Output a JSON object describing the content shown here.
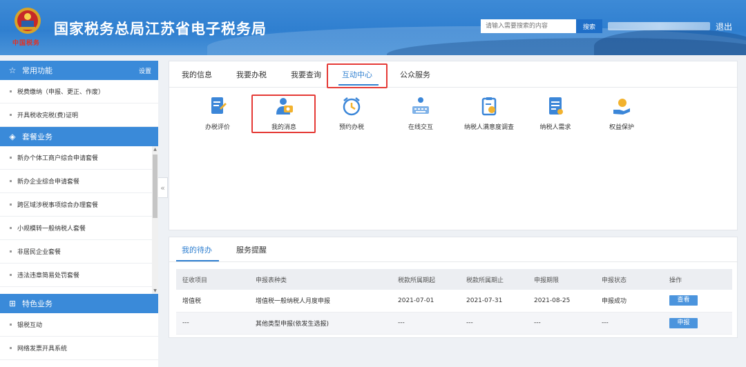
{
  "header": {
    "emblem_sub": "中国税务",
    "title": "国家税务总局江苏省电子税务局",
    "search_placeholder": "请输入需要搜索的内容",
    "search_button": "搜索",
    "logout": "退出"
  },
  "sidebar": {
    "common": {
      "title": "常用功能",
      "settings": "设置",
      "items": [
        "税费缴纳（申报、更正、作废）",
        "开具税收完税(费)证明"
      ]
    },
    "package": {
      "title": "套餐业务",
      "items": [
        "新办个体工商户综合申请套餐",
        "新办企业综合申请套餐",
        "跨区域涉税事项综合办理套餐",
        "小规模转一般纳税人套餐",
        "非居民企业套餐",
        "违法违章简易处罚套餐"
      ]
    },
    "special": {
      "title": "特色业务",
      "items": [
        "银税互动",
        "网络发票开具系统"
      ]
    },
    "collapse_icon": "double-chevron-left-icon"
  },
  "main_tabs": [
    "我的信息",
    "我要办税",
    "我要查询",
    "互动中心",
    "公众服务"
  ],
  "active_tab": "互动中心",
  "services": [
    {
      "label": "办税评价",
      "icon": "document-pen-icon"
    },
    {
      "label": "我的消息",
      "icon": "user-message-icon"
    },
    {
      "label": "预约办税",
      "icon": "alarm-clock-icon"
    },
    {
      "label": "在线交互",
      "icon": "keyboard-chat-icon"
    },
    {
      "label": "纳税人满意度调查",
      "icon": "clipboard-survey-icon"
    },
    {
      "label": "纳税人需求",
      "icon": "document-list-icon"
    },
    {
      "label": "权益保护",
      "icon": "hand-coin-icon"
    }
  ],
  "todo": {
    "tabs": [
      "我的待办",
      "服务提醒"
    ],
    "active_tab": "我的待办",
    "columns": [
      "征收项目",
      "申报表种类",
      "税款所属期起",
      "税款所属期止",
      "申报期限",
      "申报状态",
      "操作"
    ],
    "rows": [
      [
        "增值税",
        "增值税一般纳税人月度申报",
        "2021-07-01",
        "2021-07-31",
        "2021-08-25",
        "申报成功",
        "查看"
      ],
      [
        "---",
        "其他类型申报(依发生选报)",
        "---",
        "---",
        "---",
        "---",
        "申报"
      ]
    ]
  },
  "colors": {
    "header_blue": "#2f7fd0",
    "sidebar_head": "#3a8ad9",
    "highlight_red": "#e53935",
    "button_blue": "#4b94dd"
  }
}
